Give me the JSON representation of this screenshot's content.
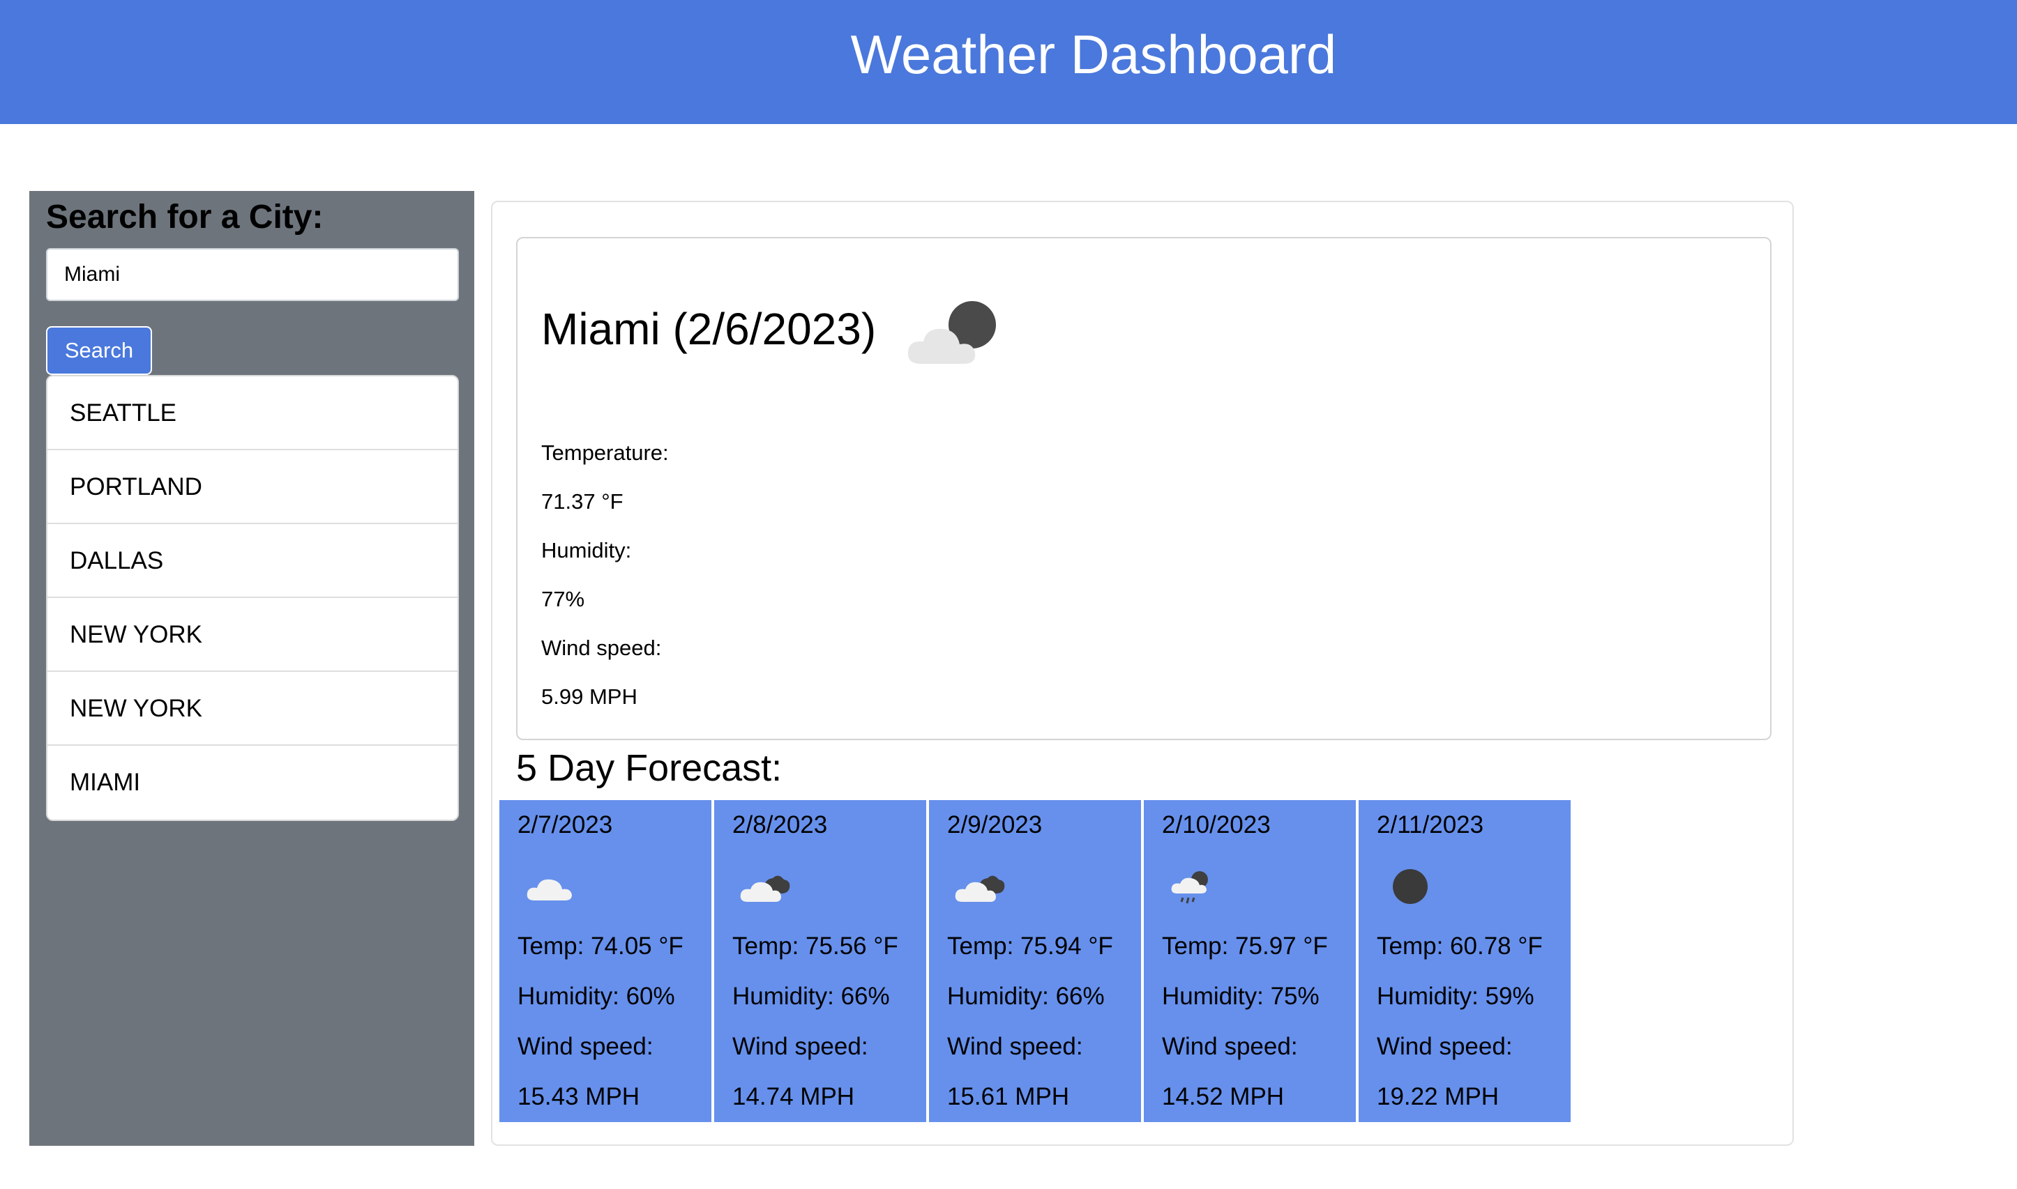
{
  "header": {
    "title": "Weather Dashboard"
  },
  "sidebar": {
    "search_title": "Search for a City:",
    "search_value": "Miami",
    "search_button": "Search",
    "cities": [
      "SEATTLE",
      "PORTLAND",
      "DALLAS",
      "NEW YORK",
      "NEW YORK",
      "MIAMI"
    ]
  },
  "current": {
    "title": "Miami (2/6/2023)",
    "icon": "cloud-night-icon",
    "temperature_label": "Temperature:",
    "temperature_value": "71.37 °F",
    "humidity_label": "Humidity:",
    "humidity_value": "77%",
    "wind_label": "Wind speed:",
    "wind_value": "5.99 MPH"
  },
  "forecast": {
    "heading": "5 Day Forecast:",
    "days": [
      {
        "date": "2/7/2023",
        "icon": "cloud-icon",
        "temp": "Temp: 74.05 °F",
        "humidity": "Humidity: 60%",
        "wind_label": "Wind speed:",
        "wind_value": "15.43 MPH"
      },
      {
        "date": "2/8/2023",
        "icon": "broken-clouds-icon",
        "temp": "Temp: 75.56 °F",
        "humidity": "Humidity: 66%",
        "wind_label": "Wind speed:",
        "wind_value": "14.74 MPH"
      },
      {
        "date": "2/9/2023",
        "icon": "broken-clouds-icon",
        "temp": "Temp: 75.94 °F",
        "humidity": "Humidity: 66%",
        "wind_label": "Wind speed:",
        "wind_value": "15.61 MPH"
      },
      {
        "date": "2/10/2023",
        "icon": "rain-icon",
        "temp": "Temp: 75.97 °F",
        "humidity": "Humidity: 75%",
        "wind_label": "Wind speed:",
        "wind_value": "14.52 MPH"
      },
      {
        "date": "2/11/2023",
        "icon": "clear-night-icon",
        "temp": "Temp: 60.78 °F",
        "humidity": "Humidity: 59%",
        "wind_label": "Wind speed:",
        "wind_value": "19.22 MPH"
      }
    ]
  },
  "colors": {
    "header_bg": "#4a78dc",
    "sidebar_bg": "#6d747c",
    "forecast_card_bg": "#6690ec",
    "button_bg": "#4a78dc"
  }
}
